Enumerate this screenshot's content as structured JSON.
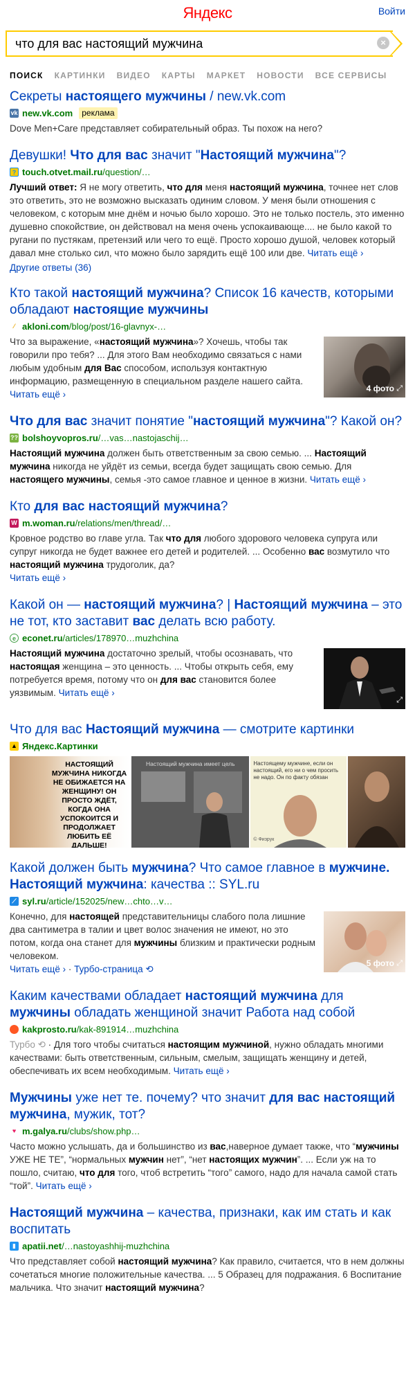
{
  "header": {
    "logo": "Яндекс",
    "login": "Войти"
  },
  "search": {
    "query": "что для вас настоящий мужчина"
  },
  "tabs": [
    "поиск",
    "картинки",
    "видео",
    "карты",
    "маркет",
    "новости",
    "все сервисы"
  ],
  "results": {
    "r1": {
      "title_1": "Секреты ",
      "title_b1": "настоящего мужчины",
      "title_2": " / new.vk.com",
      "url": "new.vk.com",
      "ad": "реклама",
      "snippet": "Dove Men+Care представляет собирательный образ. Ты похож на него?"
    },
    "r2": {
      "title_1": "Девушки! ",
      "title_b1": "Что для вас",
      "title_2": " значит \"",
      "title_b2": "Настоящий мужчина",
      "title_3": "\"?",
      "url_b": "touch.otvet.mail.ru",
      "url_rest": "/question/…",
      "snippet_b1": "Лучший ответ:",
      "snippet_1": " Я не могу ответить, ",
      "snippet_b2": "что для",
      "snippet_2": " меня ",
      "snippet_b3": "настоящий мужчина",
      "snippet_3": ", точнее нет слов это ответить, это не возможно высказать одиним словом. У меня были отношения с человеком, с которым мне днём и ночью было хорошо. Это не только постель, это именно душевно спокойствие, он действовал на меня очень успокаивающе.... не было какой то ругани по пустякам, претензий или чего то ещё. Просто хорошо душой, человек который давал мне столько сил, что можно было зарядить ещё 100 или две. ",
      "more": "Читать ещё ›",
      "other": "Другие ответы (36)"
    },
    "r3": {
      "title_1": "Кто такой ",
      "title_b1": "настоящий мужчина",
      "title_2": "? Список 16 качеств, которыми обладают ",
      "title_b2": "настоящие мужчины",
      "url_b": "akloni.com",
      "url_rest": "/blog/post/16-glavnyx-…",
      "snippet_1": "Что за выражение, «",
      "snippet_b1": "настоящий мужчина",
      "snippet_2": "»? Хочешь, чтобы так говорили про тебя? ... Для этого Вам необходимо связаться с нами любым удобным ",
      "snippet_b2": "для Вас",
      "snippet_3": " способом, используя контактную информацию, размещенную в специальном разделе нашего сайта. ",
      "more": "Читать ещё ›",
      "badge": "4 фото"
    },
    "r4": {
      "title_b1": "Что для вас",
      "title_1": " значит понятие \"",
      "title_b2": "настоящий мужчина",
      "title_2": "\"? Какой он?",
      "url_b": "bolshoyvopros.ru",
      "url_rest": "/…vas…nastojaschij…",
      "snippet_b1": "Настоящий мужчина",
      "snippet_1": " должен быть ответственным за свою семью. ... ",
      "snippet_b2": "Настоящий мужчина",
      "snippet_2": " никогда не уйдёт из семьи, всегда будет защищать свою семью. Для ",
      "snippet_b3": "настоящего мужчины",
      "snippet_3": ", семья -это самое главное и ценное в жизни. ",
      "more": "Читать ещё ›"
    },
    "r5": {
      "title_1": "Кто ",
      "title_b1": "для вас настоящий мужчина",
      "title_2": "?",
      "url_b": "m.woman.ru",
      "url_rest": "/relations/men/thread/…",
      "snippet_1": "Кровное родство во главе угла. Так ",
      "snippet_b1": "что для",
      "snippet_2": " любого здорового человека супруга или супруг никогда не будет важнее его детей и родителей. ... Особенно ",
      "snippet_b2": "вас",
      "snippet_3": " возмутило что ",
      "snippet_b3": "настоящий мужчина",
      "snippet_4": " трудоголик, да?",
      "more": "Читать ещё ›"
    },
    "r6": {
      "title_1": "Какой он — ",
      "title_b1": "настоящий мужчина",
      "title_2": "? | ",
      "title_b2": "Настоящий мужчина",
      "title_3": " – это не тот, кто заставит ",
      "title_b3": "вас",
      "title_4": " делать всю работу.",
      "url_b": "econet.ru",
      "url_rest": "/articles/178970…muzhchina",
      "snippet_b1": "Настоящий мужчина",
      "snippet_1": " достаточно зрелый, чтобы осознавать, что ",
      "snippet_b2": "настоящая",
      "snippet_2": " женщина – это ценность. ... Чтобы открыть себя, ему потребуется время, потому что он ",
      "snippet_b3": "для вас",
      "snippet_3": " становится более уязвимым. ",
      "more": "Читать ещё ›"
    },
    "r7": {
      "title_1": "Что для вас ",
      "title_b1": "Настоящий мужчина",
      "title_2": " — смотрите картинки",
      "source": "Яндекс.Картинки",
      "img1_text": "НАСТОЯЩИЙ МУЖЧИНА НИКОГДА НЕ ОБИЖАЕТСЯ НА ЖЕНЩИНУ! ОН ПРОСТО ЖДЁТ, КОГДА ОНА УСПОКОИТСЯ И ПРОДОЛЖАЕТ ЛЮБИТЬ ЕЁ ДАЛЬШЕ!",
      "img2_text": "Настоящий мужчина имеет цель",
      "img3_text": "Настоящему мужчине, если он настоящий, его ни о чем просить не надо. Он по факту обязан",
      "img3_caption": "© Физрук"
    },
    "r8": {
      "title_1": "Какой должен быть ",
      "title_b1": "мужчина",
      "title_2": "? Что самое главное в ",
      "title_b2": "мужчине. Настоящий мужчина",
      "title_3": ": качества :: SYL.ru",
      "url_b": "syl.ru",
      "url_rest": "/article/152025/new…chto…v…",
      "snippet_1": "Конечно, для ",
      "snippet_b1": "настоящей",
      "snippet_2": " представительницы слабого пола лишние два сантиметра в талии и цвет волос значения не имеют, но это потом, когда она станет для ",
      "snippet_b2": "мужчины",
      "snippet_3": " близким и практически родным человеком.",
      "more": "Читать ещё ›",
      "turbo": "Турбо-страница",
      "badge": "5 фото"
    },
    "r9": {
      "title_1": "Каким качествами обладает ",
      "title_b1": "настоящий мужчина",
      "title_2": " для ",
      "title_b2": "мужчины",
      "title_3": " обладать женщиной значит Работа над собой",
      "url_b": "kakprosto.ru",
      "url_rest": "/kak-891914…muzhchina",
      "turbo_label": "Турбо",
      "snippet_1": " · Для того чтобы считаться ",
      "snippet_b1": "настоящим мужчиной",
      "snippet_2": ", нужно обладать многими качествами: быть ответственным, сильным, смелым, защищать женщину и детей, обеспечивать их всем необходимым. ",
      "more": "Читать ещё ›"
    },
    "r10": {
      "title_b1": "Мужчины",
      "title_1": " уже нет те. почему? что значит ",
      "title_b2": "для вас настоящий мужчина",
      "title_2": ", мужик, тот?",
      "url_b": "m.galya.ru",
      "url_rest": "/clubs/show.php…",
      "snippet_1": "Часто можно услышать, да и большинство из ",
      "snippet_b1": "вас",
      "snippet_2": ",наверное думает также, что “",
      "snippet_b2": "мужчины",
      "snippet_3": " УЖЕ НЕ ТЕ”, “нормальных ",
      "snippet_b3": "мужчин",
      "snippet_4": " нет”, “нет ",
      "snippet_b4": "настоящих мужчин",
      "snippet_5": "”. ... Если уж на то пошло, считаю, ",
      "snippet_b5": "что для",
      "snippet_6": " того, чтоб встретить “того” самого, надо для начала самой стать “той”. ",
      "more": "Читать ещё ›"
    },
    "r11": {
      "title_b1": "Настоящий мужчина",
      "title_1": " – качества, признаки, как им стать и как воспитать",
      "url_b": "apatii.net",
      "url_rest": "/…nastoyashhij-muzhchina",
      "snippet_1": "Что представляет собой ",
      "snippet_b1": "настоящий мужчина",
      "snippet_2": "? Как правило, считается, что в нем должны сочетаться многие положительные качества. ... 5 Образец для подражания. 6 Воспитание мальчика. Что значит ",
      "snippet_b2": "настоящий мужчина",
      "snippet_3": "?"
    }
  }
}
